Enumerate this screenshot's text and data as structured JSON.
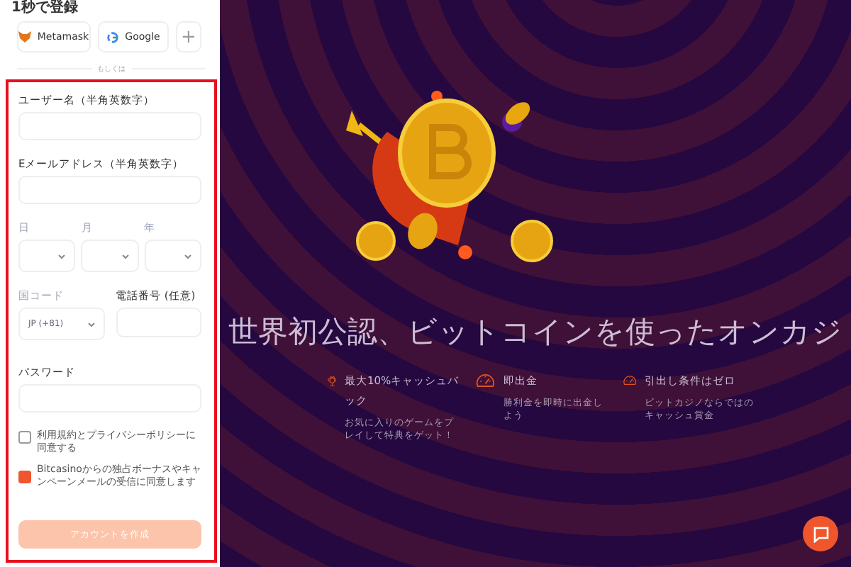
{
  "signup": {
    "title": "1秒で登録",
    "providers": [
      {
        "kind": "metamask",
        "label": "Metamask"
      },
      {
        "kind": "google",
        "label": "Google"
      },
      {
        "kind": "more",
        "label": "+"
      }
    ],
    "divider": "もしくは",
    "username": {
      "label": "ユーザー名（半角英数字）",
      "muted": false
    },
    "email": {
      "label": "Eメールアドレス（半角英数字）",
      "muted": false
    },
    "birth": [
      {
        "label": "日",
        "muted": true
      },
      {
        "label": "月",
        "muted": true
      },
      {
        "label": "年",
        "muted": true
      }
    ],
    "country_code": {
      "label": "国コード",
      "muted": true,
      "value": "JP (+81)"
    },
    "phone": {
      "label": "電話番号 (任意)",
      "muted": false
    },
    "password": {
      "label": "パスワード",
      "muted": false
    },
    "consents": [
      {
        "text": "利用規約とプライバシーポリシーに同意する",
        "checked": false
      },
      {
        "text": "Bitcasinoからの独占ボーナスやキャンペーンメールの受信に同意します",
        "checked": true
      }
    ],
    "submit": {
      "label": "アカウントを作成",
      "disabled": true
    }
  },
  "hero": {
    "headline": "世界初公認、ビットコインを使ったオンカジ",
    "features": [
      {
        "kind": "trophy",
        "title": "最大10%キャッシュバック",
        "description": "お気に入りのゲームをプレイして特典をゲット！"
      },
      {
        "kind": "gauge",
        "title": "即出金",
        "description": "勝利金を即時に出金しよう"
      },
      {
        "kind": "gauge",
        "title": "引出し条件はゼロ",
        "description": "ビットカジノならではのキャッシュ賞金"
      }
    ]
  }
}
